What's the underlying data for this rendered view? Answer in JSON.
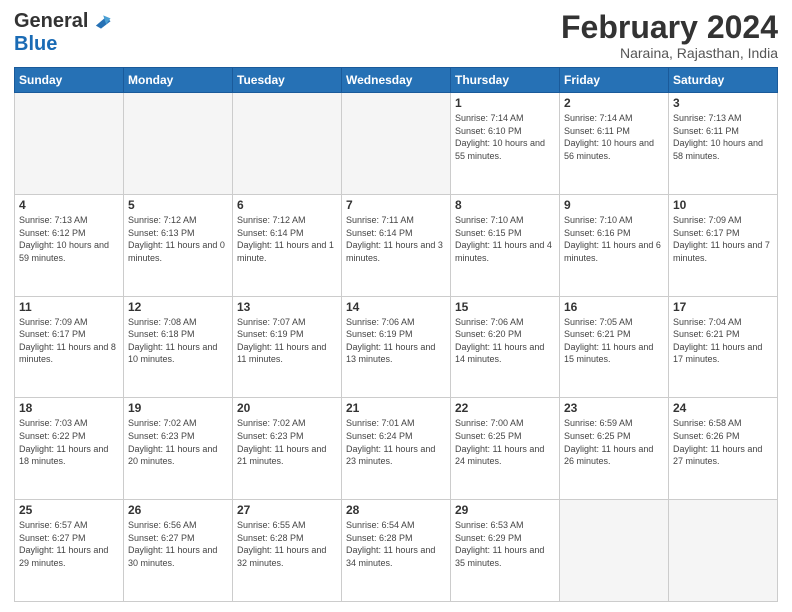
{
  "header": {
    "logo_general": "General",
    "logo_blue": "Blue",
    "main_title": "February 2024",
    "subtitle": "Naraina, Rajasthan, India"
  },
  "days_of_week": [
    "Sunday",
    "Monday",
    "Tuesday",
    "Wednesday",
    "Thursday",
    "Friday",
    "Saturday"
  ],
  "weeks": [
    [
      {
        "day": "",
        "info": ""
      },
      {
        "day": "",
        "info": ""
      },
      {
        "day": "",
        "info": ""
      },
      {
        "day": "",
        "info": ""
      },
      {
        "day": "1",
        "info": "Sunrise: 7:14 AM\nSunset: 6:10 PM\nDaylight: 10 hours\nand 55 minutes."
      },
      {
        "day": "2",
        "info": "Sunrise: 7:14 AM\nSunset: 6:11 PM\nDaylight: 10 hours\nand 56 minutes."
      },
      {
        "day": "3",
        "info": "Sunrise: 7:13 AM\nSunset: 6:11 PM\nDaylight: 10 hours\nand 58 minutes."
      }
    ],
    [
      {
        "day": "4",
        "info": "Sunrise: 7:13 AM\nSunset: 6:12 PM\nDaylight: 10 hours\nand 59 minutes."
      },
      {
        "day": "5",
        "info": "Sunrise: 7:12 AM\nSunset: 6:13 PM\nDaylight: 11 hours\nand 0 minutes."
      },
      {
        "day": "6",
        "info": "Sunrise: 7:12 AM\nSunset: 6:14 PM\nDaylight: 11 hours\nand 1 minute."
      },
      {
        "day": "7",
        "info": "Sunrise: 7:11 AM\nSunset: 6:14 PM\nDaylight: 11 hours\nand 3 minutes."
      },
      {
        "day": "8",
        "info": "Sunrise: 7:10 AM\nSunset: 6:15 PM\nDaylight: 11 hours\nand 4 minutes."
      },
      {
        "day": "9",
        "info": "Sunrise: 7:10 AM\nSunset: 6:16 PM\nDaylight: 11 hours\nand 6 minutes."
      },
      {
        "day": "10",
        "info": "Sunrise: 7:09 AM\nSunset: 6:17 PM\nDaylight: 11 hours\nand 7 minutes."
      }
    ],
    [
      {
        "day": "11",
        "info": "Sunrise: 7:09 AM\nSunset: 6:17 PM\nDaylight: 11 hours\nand 8 minutes."
      },
      {
        "day": "12",
        "info": "Sunrise: 7:08 AM\nSunset: 6:18 PM\nDaylight: 11 hours\nand 10 minutes."
      },
      {
        "day": "13",
        "info": "Sunrise: 7:07 AM\nSunset: 6:19 PM\nDaylight: 11 hours\nand 11 minutes."
      },
      {
        "day": "14",
        "info": "Sunrise: 7:06 AM\nSunset: 6:19 PM\nDaylight: 11 hours\nand 13 minutes."
      },
      {
        "day": "15",
        "info": "Sunrise: 7:06 AM\nSunset: 6:20 PM\nDaylight: 11 hours\nand 14 minutes."
      },
      {
        "day": "16",
        "info": "Sunrise: 7:05 AM\nSunset: 6:21 PM\nDaylight: 11 hours\nand 15 minutes."
      },
      {
        "day": "17",
        "info": "Sunrise: 7:04 AM\nSunset: 6:21 PM\nDaylight: 11 hours\nand 17 minutes."
      }
    ],
    [
      {
        "day": "18",
        "info": "Sunrise: 7:03 AM\nSunset: 6:22 PM\nDaylight: 11 hours\nand 18 minutes."
      },
      {
        "day": "19",
        "info": "Sunrise: 7:02 AM\nSunset: 6:23 PM\nDaylight: 11 hours\nand 20 minutes."
      },
      {
        "day": "20",
        "info": "Sunrise: 7:02 AM\nSunset: 6:23 PM\nDaylight: 11 hours\nand 21 minutes."
      },
      {
        "day": "21",
        "info": "Sunrise: 7:01 AM\nSunset: 6:24 PM\nDaylight: 11 hours\nand 23 minutes."
      },
      {
        "day": "22",
        "info": "Sunrise: 7:00 AM\nSunset: 6:25 PM\nDaylight: 11 hours\nand 24 minutes."
      },
      {
        "day": "23",
        "info": "Sunrise: 6:59 AM\nSunset: 6:25 PM\nDaylight: 11 hours\nand 26 minutes."
      },
      {
        "day": "24",
        "info": "Sunrise: 6:58 AM\nSunset: 6:26 PM\nDaylight: 11 hours\nand 27 minutes."
      }
    ],
    [
      {
        "day": "25",
        "info": "Sunrise: 6:57 AM\nSunset: 6:27 PM\nDaylight: 11 hours\nand 29 minutes."
      },
      {
        "day": "26",
        "info": "Sunrise: 6:56 AM\nSunset: 6:27 PM\nDaylight: 11 hours\nand 30 minutes."
      },
      {
        "day": "27",
        "info": "Sunrise: 6:55 AM\nSunset: 6:28 PM\nDaylight: 11 hours\nand 32 minutes."
      },
      {
        "day": "28",
        "info": "Sunrise: 6:54 AM\nSunset: 6:28 PM\nDaylight: 11 hours\nand 34 minutes."
      },
      {
        "day": "29",
        "info": "Sunrise: 6:53 AM\nSunset: 6:29 PM\nDaylight: 11 hours\nand 35 minutes."
      },
      {
        "day": "",
        "info": ""
      },
      {
        "day": "",
        "info": ""
      }
    ]
  ]
}
